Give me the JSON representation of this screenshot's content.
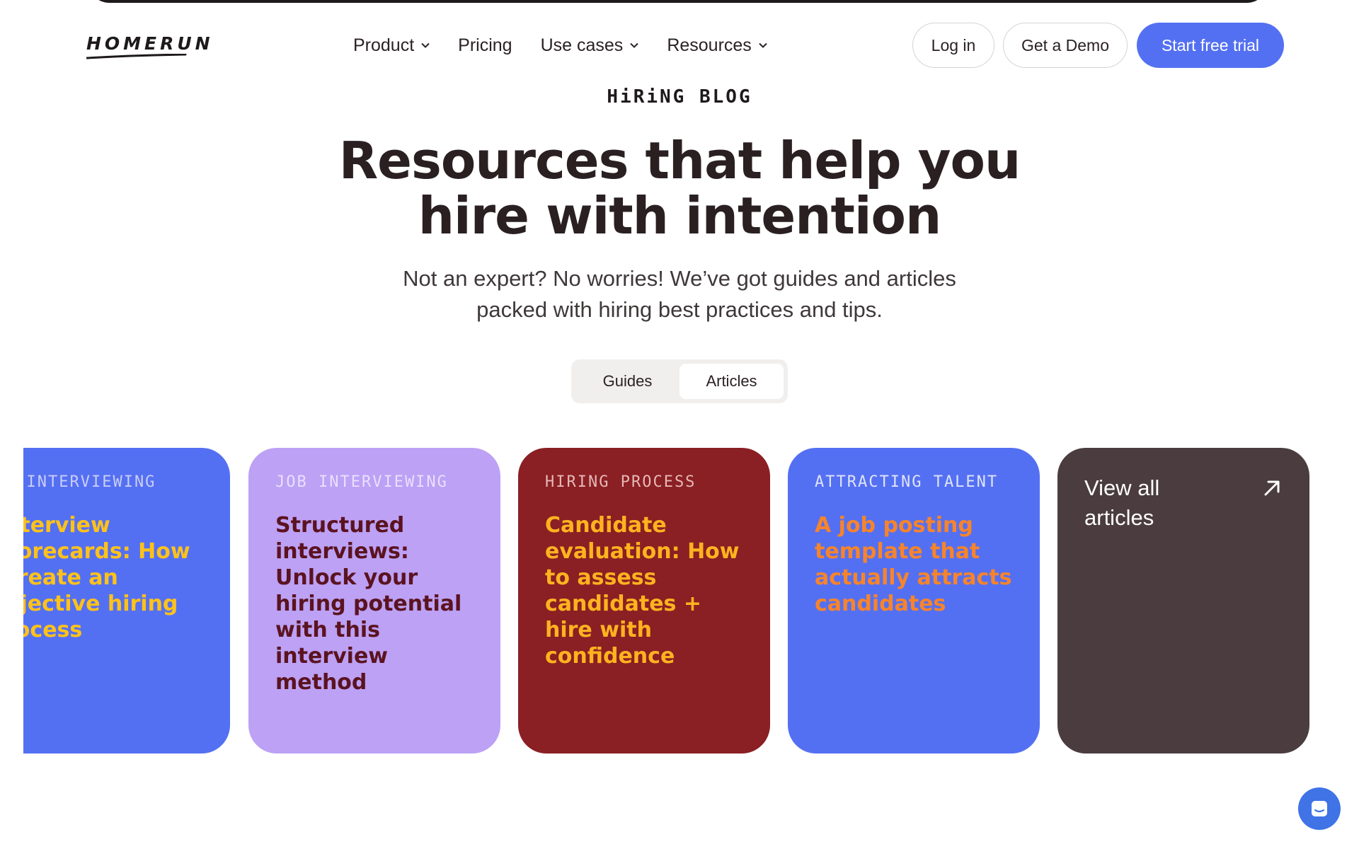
{
  "brand": {
    "logo_text": "HOMERUN"
  },
  "nav": {
    "items": [
      {
        "label": "Product",
        "has_dropdown": true
      },
      {
        "label": "Pricing",
        "has_dropdown": false
      },
      {
        "label": "Use cases",
        "has_dropdown": true
      },
      {
        "label": "Resources",
        "has_dropdown": true
      }
    ],
    "login_label": "Log in",
    "demo_label": "Get a Demo",
    "trial_label": "Start free trial"
  },
  "hero": {
    "eyebrow": "HiRiNG BLOG",
    "title_line1": "Resources that help you",
    "title_line2": "hire with intention",
    "subtitle_line1": "Not an expert? No worries! We’ve got guides and articles",
    "subtitle_line2": "packed with hiring best practices and tips."
  },
  "tabs": {
    "items": [
      "Guides",
      "Articles"
    ],
    "active": "Articles"
  },
  "cards": [
    {
      "category": "b interviewing",
      "title": "nterview corecards: How create an bjective hiring rocess",
      "bg": "#5470f2",
      "category_color": "#c9cdf7",
      "title_color": "#ffc21a"
    },
    {
      "category": "Job interviewing",
      "title": "Structured interviews: Unlock your hiring potential with this interview method",
      "bg": "#bca1f5",
      "category_color": "#eadffd",
      "title_color": "#5b1320"
    },
    {
      "category": "Hiring process",
      "title": "Candidate evaluation: How to assess candidates + hire with confidence",
      "bg": "#8a1f24",
      "category_color": "#e6b8b6",
      "title_color": "#ffb31f"
    },
    {
      "category": "Attracting talent",
      "title": "A job posting template that actually attracts candidates",
      "bg": "#5470f2",
      "category_color": "#dfe3fb",
      "title_color": "#f7842b"
    }
  ],
  "view_all": {
    "label": "View all articles",
    "bg": "#4a3c3f",
    "icon": "arrow-up-right-icon"
  },
  "chat": {
    "icon": "chat-icon",
    "color": "#3f73e6"
  }
}
